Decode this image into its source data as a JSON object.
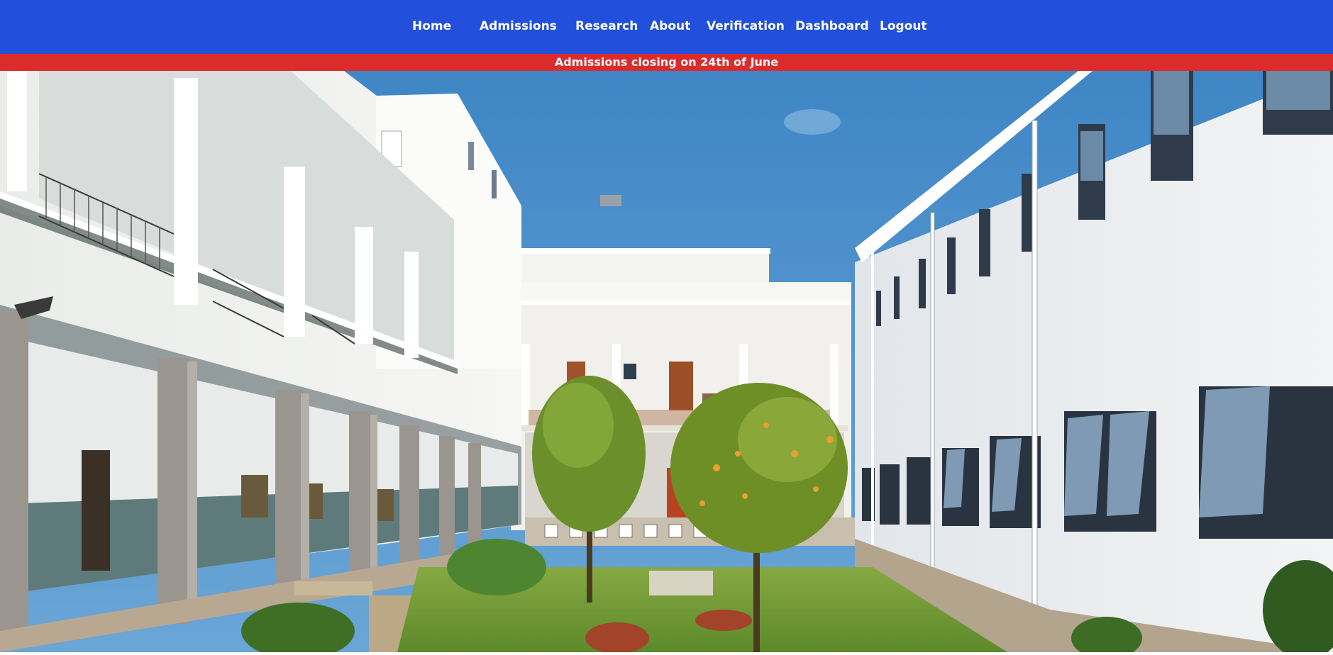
{
  "nav": {
    "items": [
      {
        "label": "Home"
      },
      {
        "label": "Admissions"
      },
      {
        "label": "Research"
      },
      {
        "label": "About"
      },
      {
        "label": "Verification"
      },
      {
        "label": "Dashboard"
      },
      {
        "label": "Logout"
      }
    ]
  },
  "banner": {
    "text": "Admissions closing on 24th of June"
  },
  "colors": {
    "navbar": "#2250dc",
    "banner": "#dc2b2b",
    "nav_text": "#ffffff"
  },
  "hero": {
    "icon": "campus-courtyard-photo"
  }
}
